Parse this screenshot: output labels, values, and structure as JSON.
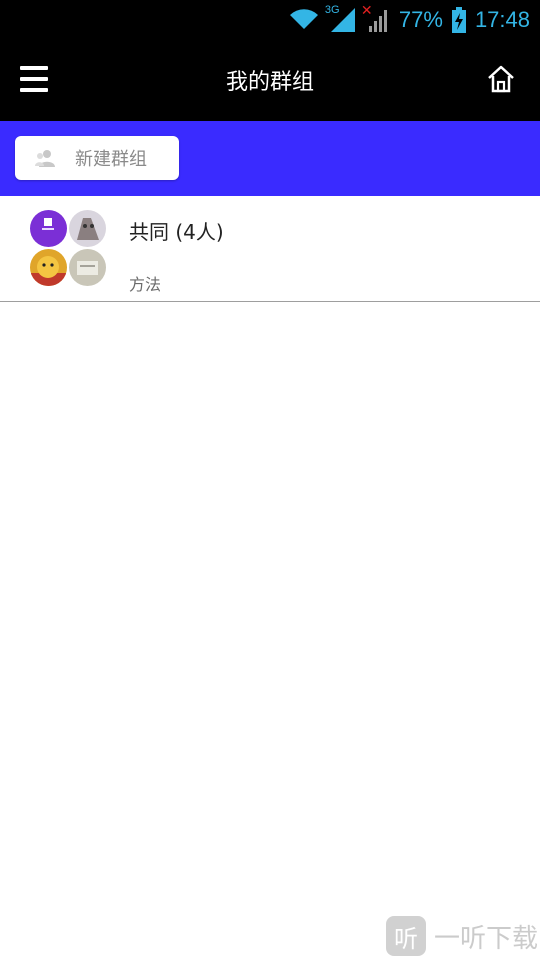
{
  "status_bar": {
    "network_type": "3G",
    "battery_percent": "77%",
    "time": "17:48"
  },
  "app_bar": {
    "title": "我的群组"
  },
  "toolbar": {
    "new_group_label": "新建群组"
  },
  "groups": [
    {
      "name": "共同 (4人)",
      "description": "方法"
    }
  ],
  "watermark": {
    "badge": "听",
    "text": "一听下载"
  },
  "colors": {
    "app_bar_bg": "#000000",
    "toolbar_bg": "#3a2bff",
    "status_icon": "#33b5e5"
  }
}
